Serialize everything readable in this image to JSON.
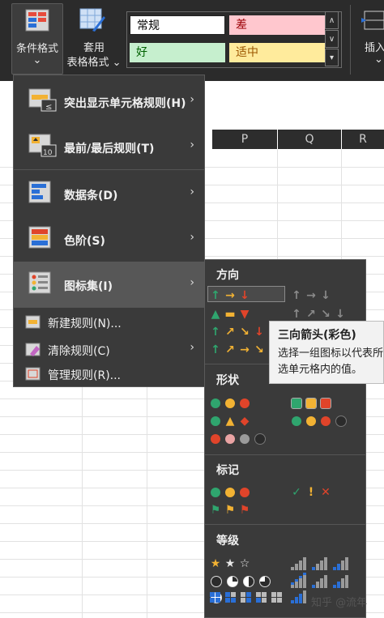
{
  "ribbon": {
    "conditional_format": {
      "label": "条件格式",
      "dropdown": "⌄"
    },
    "table_format": {
      "line1": "套用",
      "line2": "表格格式",
      "dropdown": "⌄"
    },
    "styles": [
      {
        "label": "常规",
        "bg": "#ffffff",
        "fg": "#000000"
      },
      {
        "label": "差",
        "bg": "#ffc7ce",
        "fg": "#9c0006"
      },
      {
        "label": "好",
        "bg": "#c6efce",
        "fg": "#006100"
      },
      {
        "label": "适中",
        "bg": "#ffeb9c",
        "fg": "#9c5700"
      }
    ],
    "insert": {
      "label": "插入",
      "dropdown": "⌄"
    }
  },
  "columns": [
    "P",
    "Q",
    "R"
  ],
  "menu": {
    "items": [
      {
        "label": "突出显示单元格规则(H)",
        "icon": "highlight-rules-icon"
      },
      {
        "label": "最前/最后规则(T)",
        "icon": "top-bottom-rules-icon"
      },
      {
        "label": "数据条(D)",
        "icon": "data-bars-icon"
      },
      {
        "label": "色阶(S)",
        "icon": "color-scales-icon"
      },
      {
        "label": "图标集(I)",
        "icon": "icon-sets-icon"
      }
    ],
    "small_items": [
      {
        "label": "新建规则(N)...",
        "icon": "new-rule-icon"
      },
      {
        "label": "清除规则(C)",
        "icon": "clear-rules-icon"
      },
      {
        "label": "管理规则(R)...",
        "icon": "manage-rules-icon"
      }
    ]
  },
  "submenu": {
    "sections": {
      "directional": "方向",
      "shapes": "形状",
      "indicators": "标记",
      "ratings": "等级"
    }
  },
  "tooltip": {
    "title": "三向箭头(彩色)",
    "line1": "选择一组图标以代表所",
    "line2": "选单元格内的值。"
  },
  "watermark": "知乎 @流年",
  "colors": {
    "green": "#2fa56e",
    "yellow": "#f2b233",
    "red": "#e0442a",
    "gray": "#8a8a8a"
  }
}
